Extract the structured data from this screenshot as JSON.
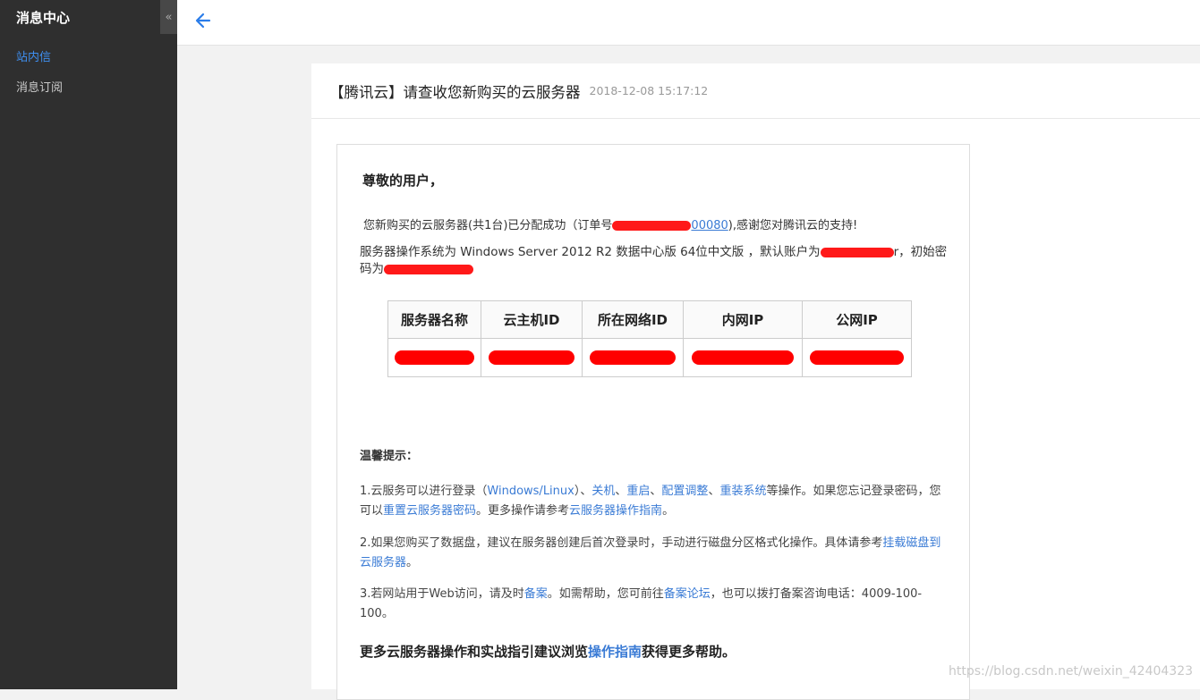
{
  "sidebar": {
    "title": "消息中心",
    "collapse_glyph": "«",
    "items": [
      {
        "label": "站内信",
        "active": true
      },
      {
        "label": "消息订阅",
        "active": false
      }
    ]
  },
  "topbar": {
    "back_icon": "arrow-left-icon"
  },
  "message": {
    "title": "【腾讯云】请查收您新购买的云服务器",
    "time": "2018-12-08 15:17:12"
  },
  "mail": {
    "greeting": "尊敬的用户，",
    "p1_before": "您新购买的云服务器(共1台)已分配成功（订单号",
    "p1_order_visible": "00080",
    "p1_after": "),感谢您对腾讯云的支持!",
    "p2_a": "服务器操作系统为 Windows Server 2012 R2 数据中心版 64位中文版 ，默认账户为",
    "p2_account_visible": "r",
    "p2_b": "，初始密码为",
    "table": {
      "headers": [
        "服务器名称",
        "云主机ID",
        "所在网络ID",
        "内网IP",
        "公网IP"
      ]
    },
    "tips_title": "温馨提示：",
    "tip1": {
      "t1": "1.云服务可以进行登录（",
      "l1": "Windows/Linux",
      "t2": "）、",
      "l2": "关机",
      "t3": "、",
      "l3": "重启",
      "t4": "、",
      "l4": "配置调整",
      "t5": "、",
      "l5": "重装系统",
      "t6": "等操作。如果您忘记登录密码，您可以",
      "l6": "重置云服务器密码",
      "t7": "。更多操作请参考",
      "l7": "云服务器操作指南",
      "t8": "。"
    },
    "tip2": {
      "t1": "2.如果您购买了数据盘，建议在服务器创建后首次登录时，手动进行磁盘分区格式化操作。具体请参考",
      "l1": "挂载磁盘到云服务器",
      "t2": "。"
    },
    "tip3": {
      "t1": "3.若网站用于Web访问，请及时",
      "l1": "备案",
      "t2": "。如需帮助，您可前往",
      "l2": "备案论坛",
      "t3": "，也可以拨打备案咨询电话：4009-100-100。"
    },
    "more": {
      "t1": "更多云服务器操作和实战指引建议浏览",
      "l1": "操作指南",
      "t2": "获得更多帮助。"
    }
  },
  "watermark": "https://blog.csdn.net/weixin_42404323",
  "colors": {
    "sidebar_bg": "#2f2f2f",
    "accent": "#3f8ff0",
    "link": "#3a7bd5",
    "redaction": "#ff0000"
  }
}
